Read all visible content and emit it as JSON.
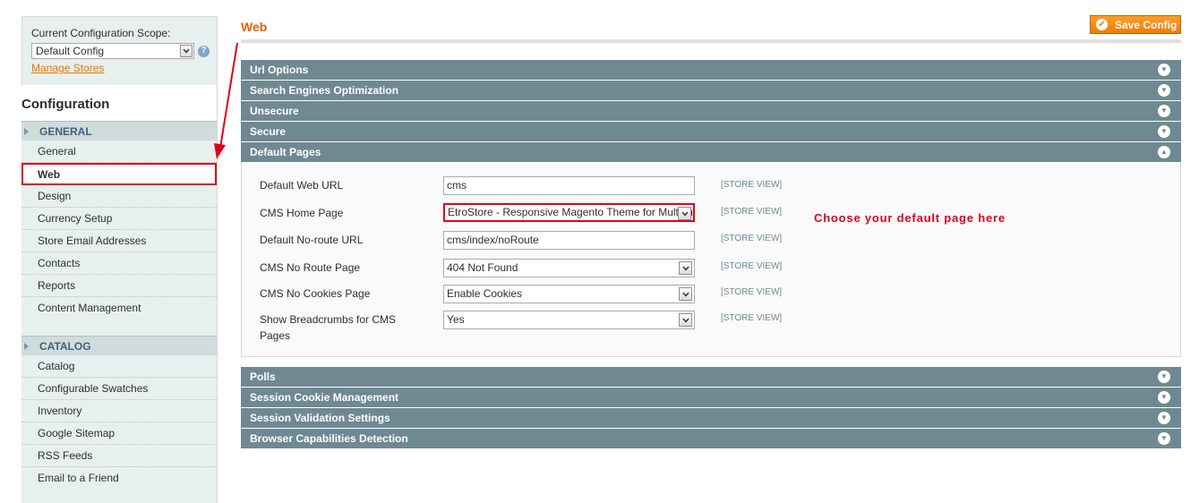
{
  "scope": {
    "label": "Current Configuration Scope:",
    "selected": "Default Config",
    "manage_link": "Manage Stores"
  },
  "sidebar": {
    "title": "Configuration",
    "groups": [
      {
        "label": "GENERAL",
        "items": [
          "General",
          "Web",
          "Design",
          "Currency Setup",
          "Store Email Addresses",
          "Contacts",
          "Reports",
          "Content Management"
        ]
      },
      {
        "label": "CATALOG",
        "items": [
          "Catalog",
          "Configurable Swatches",
          "Inventory",
          "Google Sitemap",
          "RSS Feeds",
          "Email to a Friend"
        ]
      }
    ]
  },
  "header": {
    "title": "Web",
    "save_label": "Save Config"
  },
  "sections": {
    "before": [
      "Url Options",
      "Search Engines Optimization",
      "Unsecure",
      "Secure"
    ],
    "open": "Default Pages",
    "after": [
      "Polls",
      "Session Cookie Management",
      "Session Validation Settings",
      "Browser Capabilities Detection"
    ]
  },
  "fields": [
    {
      "label": "Default Web URL",
      "value": "cms",
      "scope": "[STORE VIEW]"
    },
    {
      "label": "CMS Home Page",
      "value": "EtroStore - Responsive Magento Theme for Multipurpose",
      "scope": "[STORE VIEW]"
    },
    {
      "label": "Default No-route URL",
      "value": "cms/index/noRoute",
      "scope": "[STORE VIEW]"
    },
    {
      "label": "CMS No Route Page",
      "value": "404 Not Found",
      "scope": "[STORE VIEW]"
    },
    {
      "label": "CMS No Cookies Page",
      "value": "Enable Cookies",
      "scope": "[STORE VIEW]"
    },
    {
      "label_line1": "Show Breadcrumbs for CMS",
      "label_line2": "Pages",
      "value": "Yes",
      "scope": "[STORE VIEW]"
    }
  ],
  "annotation": "Choose your default page here",
  "colors": {
    "accent": "#eb5e00",
    "section_bar": "#6f8992",
    "highlight": "#e2001a"
  }
}
